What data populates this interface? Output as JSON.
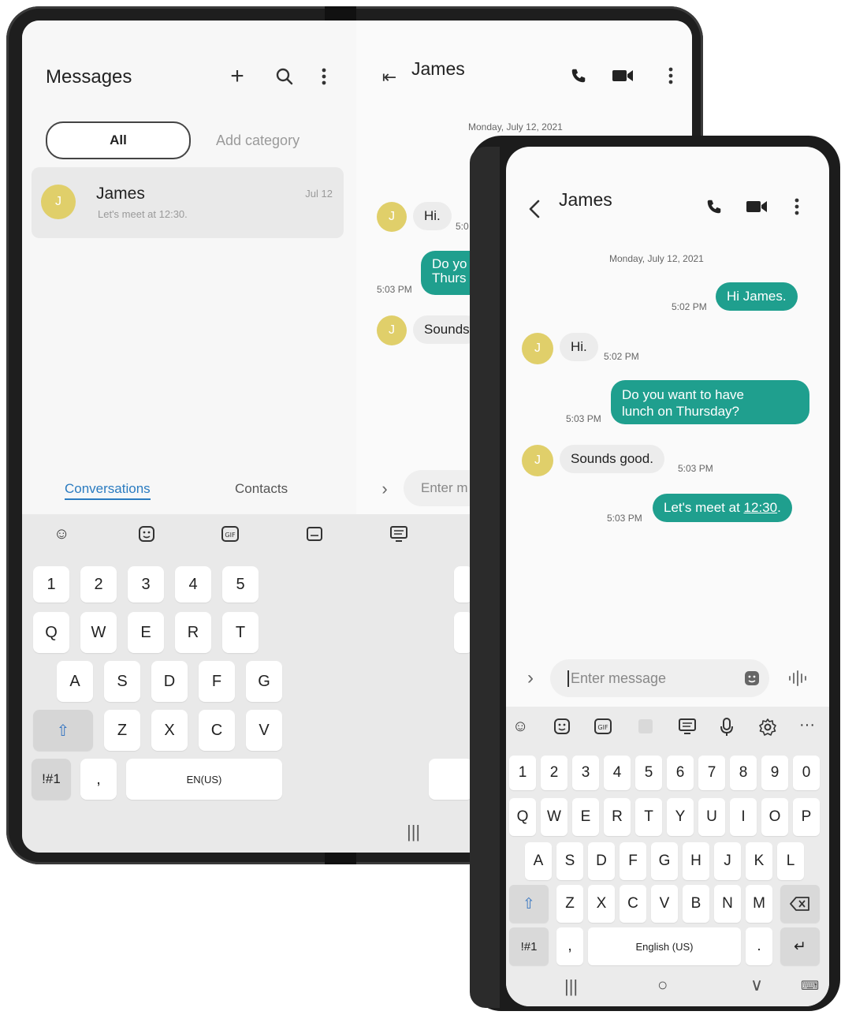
{
  "tablet": {
    "list": {
      "title": "Messages",
      "tabs": {
        "all": "All",
        "add_category": "Add category"
      },
      "conversation": {
        "name": "James",
        "avatar_letter": "J",
        "date": "Jul 12",
        "preview": "Let's meet at 12:30."
      },
      "bottom_tabs": {
        "conversations": "Conversations",
        "contacts": "Contacts"
      }
    },
    "chat": {
      "name": "James",
      "date_header": "Monday, July 12, 2021",
      "messages": [
        {
          "text": "Hi.",
          "time": "5:0",
          "direction": "in"
        },
        {
          "text": "Do yo",
          "text2": "Thurs",
          "time": "5:03 PM",
          "direction": "out"
        },
        {
          "text": "Sounds",
          "direction": "in"
        }
      ],
      "input_placeholder": "Enter m"
    },
    "keyboard": {
      "toolbar": [
        "emoji-icon",
        "sticker-icon",
        "gif-icon",
        "keyboard-icon",
        "text-icon"
      ],
      "row_numbers": [
        "1",
        "2",
        "3",
        "4",
        "5"
      ],
      "row_top": [
        "Q",
        "W",
        "E",
        "R",
        "T"
      ],
      "row_mid": [
        "A",
        "S",
        "D",
        "F",
        "G"
      ],
      "row_bottom": [
        "Z",
        "X",
        "C",
        "V"
      ],
      "symbols": "!#1",
      "comma": ",",
      "space": "EN(US)",
      "nav": "|||"
    }
  },
  "phone": {
    "chat": {
      "name": "James",
      "avatar_letter": "J",
      "date_header": "Monday, July 12, 2021",
      "messages": [
        {
          "text": "Hi James.",
          "time": "5:02 PM",
          "direction": "out"
        },
        {
          "text": "Hi.",
          "time": "5:02 PM",
          "direction": "in"
        },
        {
          "text": "Do you want to have",
          "text2": "lunch on Thursday?",
          "time": "5:03 PM",
          "direction": "out"
        },
        {
          "text": "Sounds good.",
          "time": "5:03 PM",
          "direction": "in"
        },
        {
          "text": "Let's meet at ",
          "link": "12:30",
          "tail": ".",
          "time": "5:03 PM",
          "direction": "out"
        }
      ],
      "input_placeholder": "Enter message"
    },
    "keyboard": {
      "toolbar": [
        "emoji-icon",
        "sticker-icon",
        "gif-icon",
        "handwriting-icon",
        "text-icon",
        "mic-icon",
        "settings-icon",
        "more-icon"
      ],
      "row_numbers": [
        "1",
        "2",
        "3",
        "4",
        "5",
        "6",
        "7",
        "8",
        "9",
        "0"
      ],
      "row_top": [
        "Q",
        "W",
        "E",
        "R",
        "T",
        "Y",
        "U",
        "I",
        "O",
        "P"
      ],
      "row_mid": [
        "A",
        "S",
        "D",
        "F",
        "G",
        "H",
        "J",
        "K",
        "L"
      ],
      "row_bottom": [
        "Z",
        "X",
        "C",
        "V",
        "B",
        "N",
        "M"
      ],
      "symbols": "!#1",
      "comma": ",",
      "space": "English (US)",
      "period": "."
    },
    "nav": {
      "recents": "|||",
      "home": "○",
      "back": "∨"
    }
  },
  "colors": {
    "accent": "#1f9f8e",
    "avatar": "#e0cf6a",
    "link": "#2a7bc0"
  }
}
